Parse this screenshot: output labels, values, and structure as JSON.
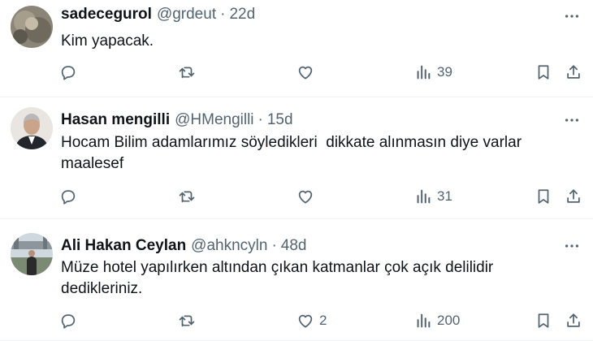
{
  "tweets": [
    {
      "name": "sadecegurol",
      "handle": "@grdeut",
      "separator": "·",
      "time": "22d",
      "text": "Kim yapacak.",
      "replies": "",
      "retweets": "",
      "likes": "",
      "views": "39"
    },
    {
      "name": "Hasan mengilli",
      "handle": "@HMengilli",
      "separator": "·",
      "time": "15d",
      "text": "Hocam Bilim adamlarımız söyledikleri  dikkate alınmasın diye varlar\nmaalesef",
      "replies": "",
      "retweets": "",
      "likes": "",
      "views": "31"
    },
    {
      "name": "Ali Hakan Ceylan",
      "handle": "@ahkncyln",
      "separator": "·",
      "time": "48d",
      "text": "Müze hotel yapılırken altından çıkan katmanlar çok açık delilidir\ndedikleriniz.",
      "replies": "",
      "retweets": "",
      "likes": "2",
      "views": "200"
    }
  ],
  "icons": {
    "avatar": "avatar-icon",
    "more": "more-icon",
    "reply": "reply-icon",
    "retweet": "retweet-icon",
    "like": "like-icon",
    "views": "views-icon",
    "bookmark": "bookmark-icon",
    "share": "share-icon"
  },
  "colors": {
    "text_primary": "#0f1419",
    "text_secondary": "#536471",
    "divider": "#eff3f4"
  }
}
